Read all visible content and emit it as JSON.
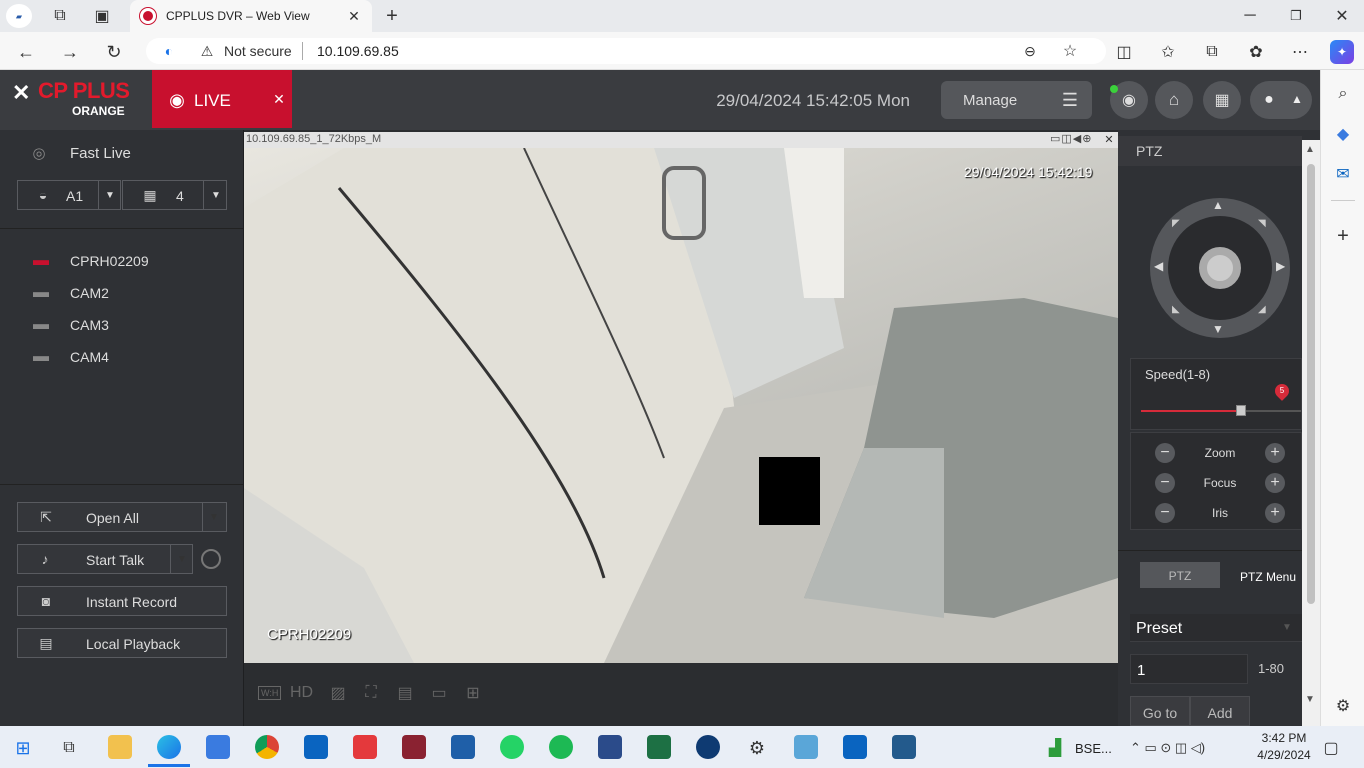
{
  "browser": {
    "tab_title": "CPPLUS DVR – Web View",
    "not_secure": "Not secure",
    "url": "10.109.69.85"
  },
  "header": {
    "logo_main": "CP PLUS",
    "logo_sub": "ORANGE",
    "live_label": "LIVE",
    "datetime": "29/04/2024 15:42:05 Mon",
    "manage_label": "Manage"
  },
  "left": {
    "fast_live": "Fast Live",
    "group_label": "A1",
    "split_label": "4",
    "cameras": [
      "CPRH02209",
      "CAM2",
      "CAM3",
      "CAM4"
    ],
    "open_all": "Open All",
    "start_talk": "Start Talk",
    "instant_record": "Instant Record",
    "local_playback": "Local Playback"
  },
  "video": {
    "stream_info": "10.109.69.85_1_72Kbps_M",
    "osd_time": "29/04/2024 15:42:19",
    "osd_name": "CPRH02209",
    "toolbar_hd": "HD",
    "toolbar_wh": "W:H"
  },
  "ptz": {
    "title": "PTZ",
    "speed_label": "Speed(1-8)",
    "speed_value": "5",
    "speed": 5,
    "speed_max": 8,
    "zoom": "Zoom",
    "focus": "Focus",
    "iris": "Iris",
    "tab_ptz": "PTZ",
    "tab_menu": "PTZ Menu",
    "preset_label": "Preset",
    "preset_value": "1",
    "preset_range": "1-80",
    "goto": "Go to",
    "add": "Add"
  },
  "taskbar": {
    "ticker": "BSE...",
    "time": "3:42 PM",
    "date": "4/29/2024"
  },
  "colors": {
    "accent": "#c8102e",
    "panel": "#2f3135"
  }
}
